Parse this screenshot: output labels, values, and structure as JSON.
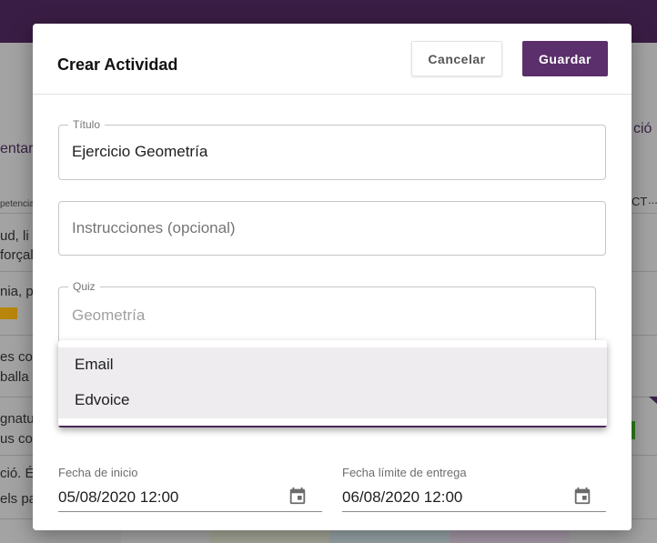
{
  "background": {
    "tab_partial": "entar",
    "right_tab_partial": "ció",
    "column_partial": "petencia",
    "column_right_partial": "CT",
    "column_right_more": "...",
    "rows": [
      [
        "ud, li c",
        "forçal"
      ],
      [
        "nia, po"
      ],
      [
        "es co",
        "balla n"
      ],
      [
        "gnatu",
        "us co"
      ],
      [
        "ció. É",
        "els par"
      ]
    ]
  },
  "dialog": {
    "title": "Crear Actividad",
    "cancel_label": "Cancelar",
    "save_label": "Guardar",
    "fields": {
      "title": {
        "legend": "Título",
        "value": "Ejercicio Geometría"
      },
      "instructions": {
        "placeholder": "Instrucciones (opcional)"
      },
      "quiz": {
        "legend": "Quiz",
        "value": "Geometría"
      }
    },
    "dropdown_options": [
      "Email",
      "Edvoice"
    ],
    "start_date": {
      "label": "Fecha de inicio",
      "value": "05/08/2020 12:00"
    },
    "due_date": {
      "label": "Fecha límite de entrega",
      "value": "06/08/2020 12:00"
    }
  },
  "colors": {
    "brand": "#5a2f6b",
    "topbar": "#3a1d44",
    "overlay": "#a3a3a3"
  },
  "icons": {
    "date_picker": "calendar-icon"
  }
}
